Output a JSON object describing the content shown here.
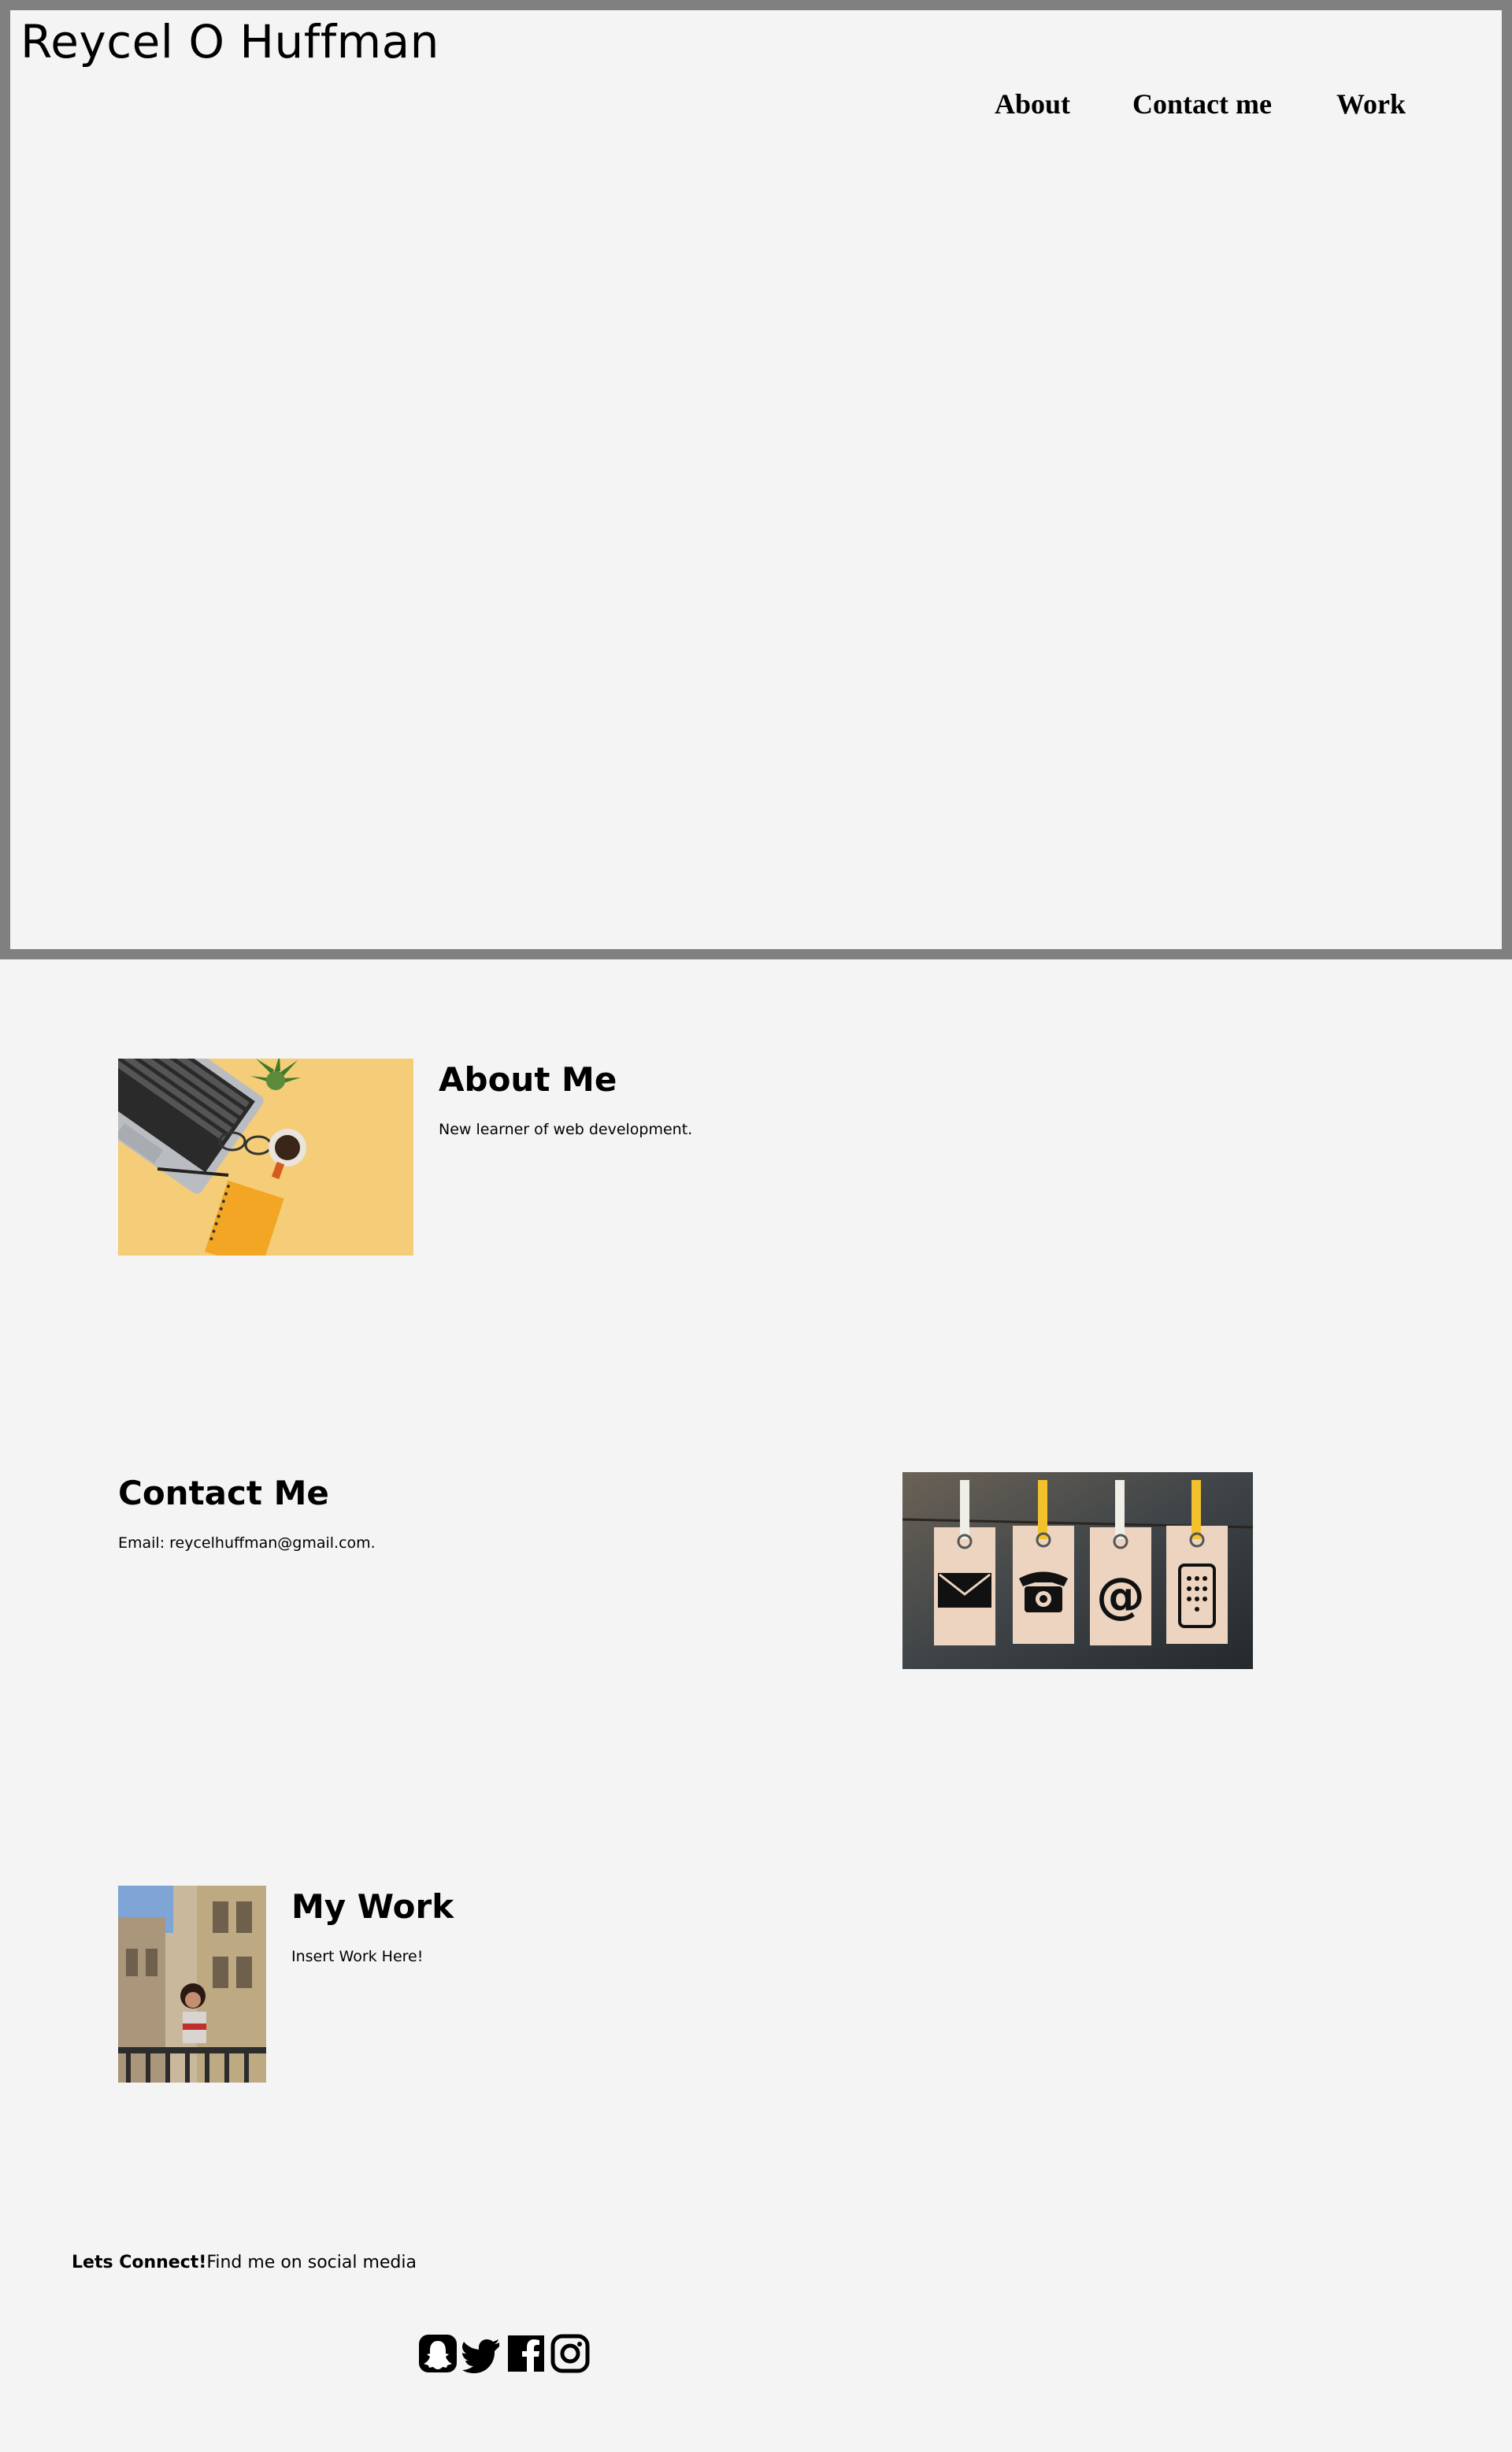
{
  "site": {
    "title": "Reycel O Huffman"
  },
  "nav": {
    "about": "About",
    "contact": "Contact me",
    "work": "Work"
  },
  "about": {
    "title": "About Me",
    "text": "New learner of web development."
  },
  "contact": {
    "title": "Contact Me",
    "text": "Email: reycelhuffman@gmail.com."
  },
  "work": {
    "title": "My Work",
    "text": "Insert Work Here!"
  },
  "footer": {
    "connect_label": "Lets Connect!",
    "connect_text": "Find me on social media",
    "social_icons": [
      "snapchat-icon",
      "twitter-icon",
      "facebook-icon",
      "instagram-icon"
    ]
  },
  "colors": {
    "background": "#f4f4f4",
    "hero_border": "#808080",
    "text": "#000000"
  }
}
